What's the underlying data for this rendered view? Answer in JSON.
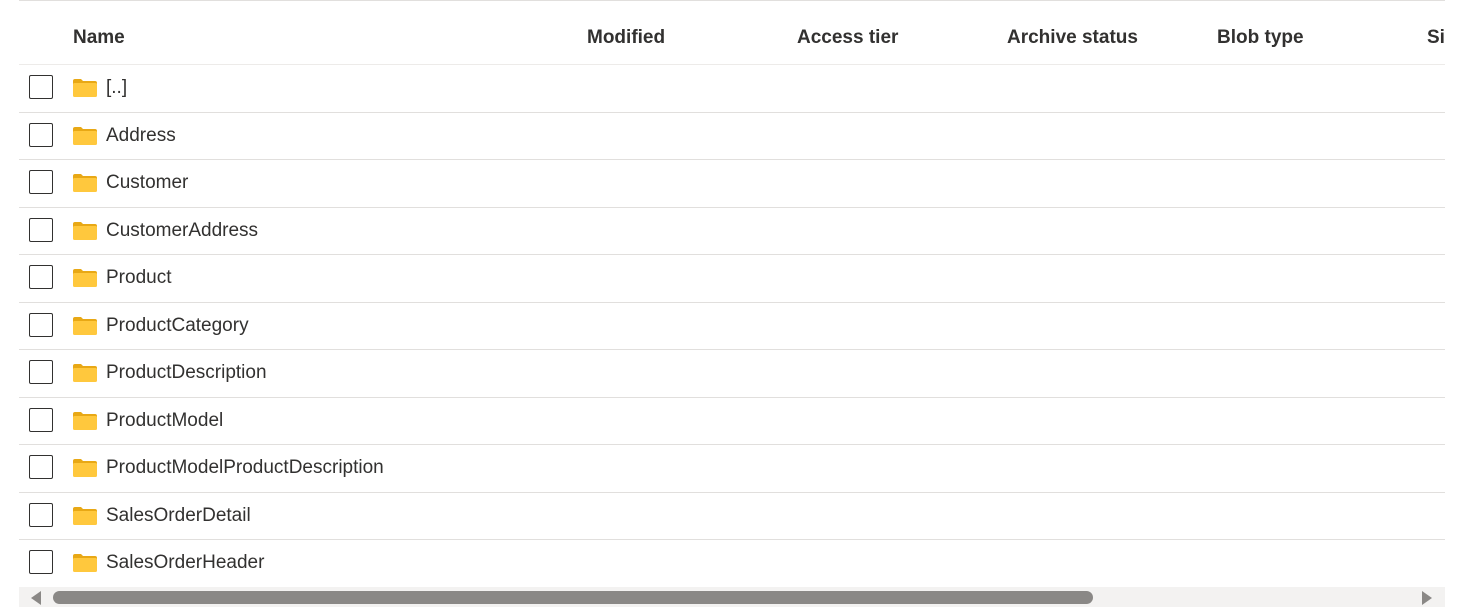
{
  "table": {
    "columns": [
      {
        "label": "Name"
      },
      {
        "label": "Modified"
      },
      {
        "label": "Access tier"
      },
      {
        "label": "Archive status"
      },
      {
        "label": "Blob type"
      },
      {
        "label": "Si:"
      }
    ],
    "rows": [
      {
        "name": "[..]"
      },
      {
        "name": "Address"
      },
      {
        "name": "Customer"
      },
      {
        "name": "CustomerAddress"
      },
      {
        "name": "Product"
      },
      {
        "name": "ProductCategory"
      },
      {
        "name": "ProductDescription"
      },
      {
        "name": "ProductModel"
      },
      {
        "name": "ProductModelProductDescription"
      },
      {
        "name": "SalesOrderDetail"
      },
      {
        "name": "SalesOrderHeader"
      }
    ]
  },
  "icons": {
    "row_icon": "folder-icon",
    "scroll_left": "chevron-left-icon",
    "scroll_right": "chevron-right-icon"
  },
  "colors": {
    "folder": "#FFC83D",
    "folder_tab": "#E8A815",
    "border": "#E1DFDD",
    "text": "#323130",
    "scrollbar_thumb": "#8A8886"
  }
}
